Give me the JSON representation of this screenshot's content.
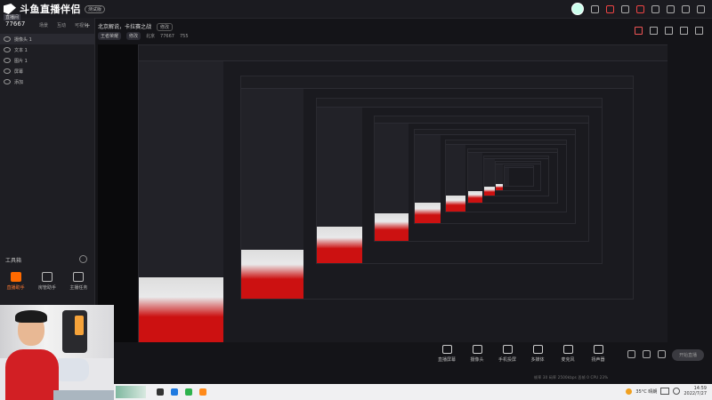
{
  "app": {
    "logo_text": "斗鱼直播伴侣",
    "beta_label": "测试版"
  },
  "room": {
    "id": "77667",
    "badge": "直播间",
    "title": "北京解说，卡拉赛之战",
    "title_button": "修改",
    "category": "王者荣耀",
    "category_button": "修改",
    "platform": "北京",
    "viewers_label": "77667",
    "hot": "755"
  },
  "sidebar": {
    "tabs": [
      "场景",
      "互动",
      "可视化"
    ],
    "sources": [
      {
        "label": "摄像头 1",
        "selected": true
      },
      {
        "label": "文本 1",
        "selected": false
      },
      {
        "label": "图片 1",
        "selected": false
      },
      {
        "label": "屏幕",
        "selected": false
      },
      {
        "label": "添加",
        "selected": false
      }
    ],
    "tools_title": "工具箱",
    "tools": [
      {
        "label": "直播助手",
        "icon": "live-assistant-icon",
        "active": true
      },
      {
        "label": "房管助手",
        "icon": "room-manager-icon",
        "active": false
      },
      {
        "label": "主播任务",
        "icon": "task-icon",
        "active": false
      }
    ]
  },
  "bottom_tools": [
    {
      "label": "直播屏幕",
      "icon": "screen-icon"
    },
    {
      "label": "摄像头",
      "icon": "camera-icon"
    },
    {
      "label": "手机投屏",
      "icon": "phone-cast-icon"
    },
    {
      "label": "多媒体",
      "icon": "media-icon"
    },
    {
      "label": "麦克风",
      "icon": "mic-icon"
    },
    {
      "label": "扬声器",
      "icon": "speaker-icon"
    }
  ],
  "go_live": "开始直播",
  "status_line": "帧率 30   码率 2500kbps   丢帧 0   CPU 23%",
  "taskbar": {
    "weather": "35°C 晴朗",
    "time": "14:59",
    "date": "2022/7/27"
  },
  "colors": {
    "accent": "#ff6a00",
    "bg": "#141418",
    "sidebar": "#1e1e23",
    "live_red": "#d21f24"
  }
}
